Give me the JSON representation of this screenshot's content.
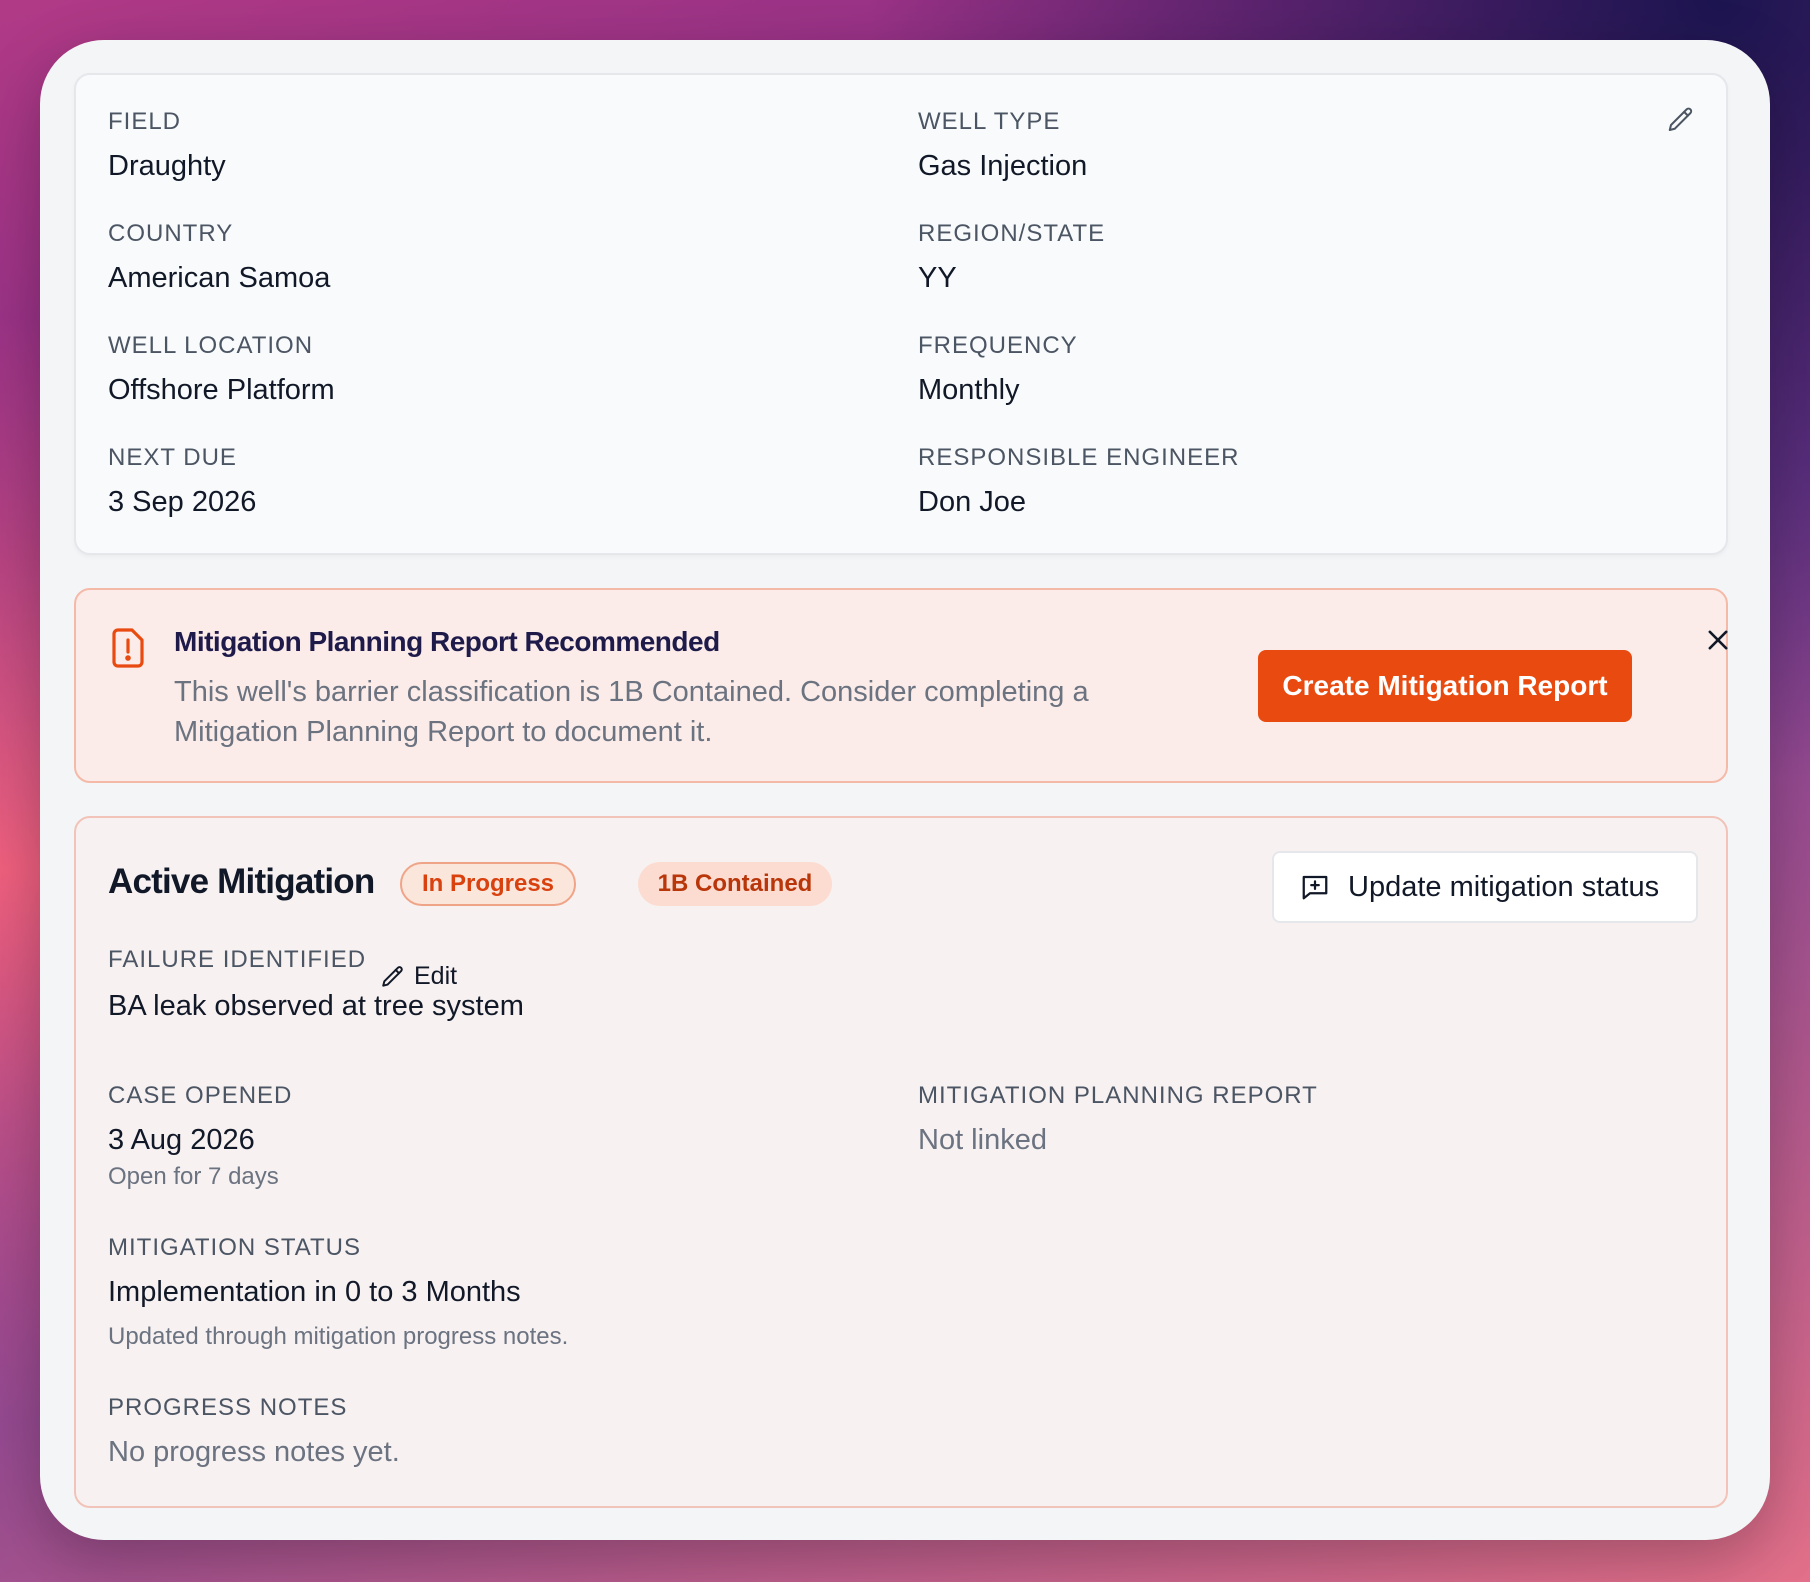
{
  "details": {
    "field_label": "FIELD",
    "field_value": "Draughty",
    "well_type_label": "WELL TYPE",
    "well_type_value": "Gas Injection",
    "country_label": "COUNTRY",
    "country_value": "American Samoa",
    "region_label": "REGION/STATE",
    "region_value": "YY",
    "location_label": "WELL LOCATION",
    "location_value": "Offshore Platform",
    "frequency_label": "FREQUENCY",
    "frequency_value": "Monthly",
    "next_due_label": "NEXT DUE",
    "next_due_value": "3 Sep 2026",
    "engineer_label": "RESPONSIBLE ENGINEER",
    "engineer_value": "Don Joe",
    "edit_icon": "pencil-icon"
  },
  "alert": {
    "title": "Mitigation Planning Report Recommended",
    "body": "This well's barrier classification is 1B Contained. Consider completing a Mitigation Planning Report to document it.",
    "action_label": "Create Mitigation Report",
    "icon": "alert-file-icon",
    "close_icon": "close-icon"
  },
  "mitigation": {
    "title": "Active Mitigation",
    "status_pill": "In Progress",
    "class_pill": "1B Contained",
    "update_label": "Update mitigation status",
    "failure_label": "FAILURE IDENTIFIED",
    "failure_edit_label": "Edit",
    "failure_value": "BA leak observed at tree system",
    "case_opened_label": "CASE OPENED",
    "case_opened_value": "3 Aug 2026",
    "case_opened_sub": "Open for 7 days",
    "mpr_label": "MITIGATION PLANNING REPORT",
    "mpr_value": "Not linked",
    "status_label": "MITIGATION STATUS",
    "status_value": "Implementation in 0 to 3 Months",
    "status_sub": "Updated through mitigation progress notes.",
    "notes_label": "PROGRESS NOTES",
    "notes_value": "No progress notes yet."
  },
  "colors": {
    "accent": "#e84a10",
    "alert_bg": "#fbece9",
    "pill_text": "#d9410f"
  }
}
